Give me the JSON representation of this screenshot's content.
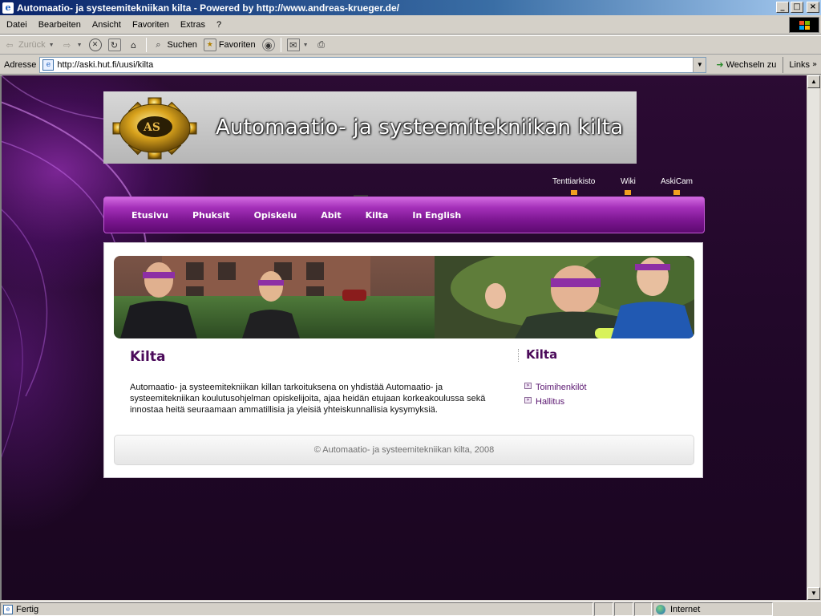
{
  "window": {
    "title": "Automaatio- ja systeemitekniikan kilta - Powered by http://www.andreas-krueger.de/",
    "controls": [
      "_",
      "□",
      "×"
    ]
  },
  "menu": [
    "Datei",
    "Bearbeiten",
    "Ansicht",
    "Favoriten",
    "Extras",
    "?"
  ],
  "toolbar": {
    "back": "Zurück",
    "search": "Suchen",
    "favorites": "Favoriten"
  },
  "address": {
    "label": "Adresse",
    "url": "http://aski.hut.fi/uusi/kilta",
    "go": "Wechseln zu",
    "links": "Links"
  },
  "page": {
    "site_title": "Automaatio- ja systeemitekniikan kilta",
    "top_links": [
      "Tenttiarkisto",
      "Wiki",
      "AskiCam"
    ],
    "nav": [
      "Etusivu",
      "Phuksit",
      "Opiskelu",
      "Abit",
      "Kilta",
      "In English"
    ],
    "main": {
      "title": "Kilta",
      "text": "Automaatio- ja systeemitekniikan killan tarkoituksena on yhdistää Automaatio- ja systeemitekniikan koulutusohjelman opiskelijoita, ajaa heidän etujaan korkeakoulussa sekä innostaa heitä seuraamaan ammatillisia ja yleisiä yhteiskunnallisia kysymyksiä."
    },
    "sidebar": {
      "title": "Kilta",
      "links": [
        "Toimihenkilöt",
        "Hallitus"
      ]
    },
    "footer": "© Automaatio- ja systeemitekniikan kilta, 2008"
  },
  "status": {
    "text": "Fertig",
    "zone": "Internet"
  }
}
